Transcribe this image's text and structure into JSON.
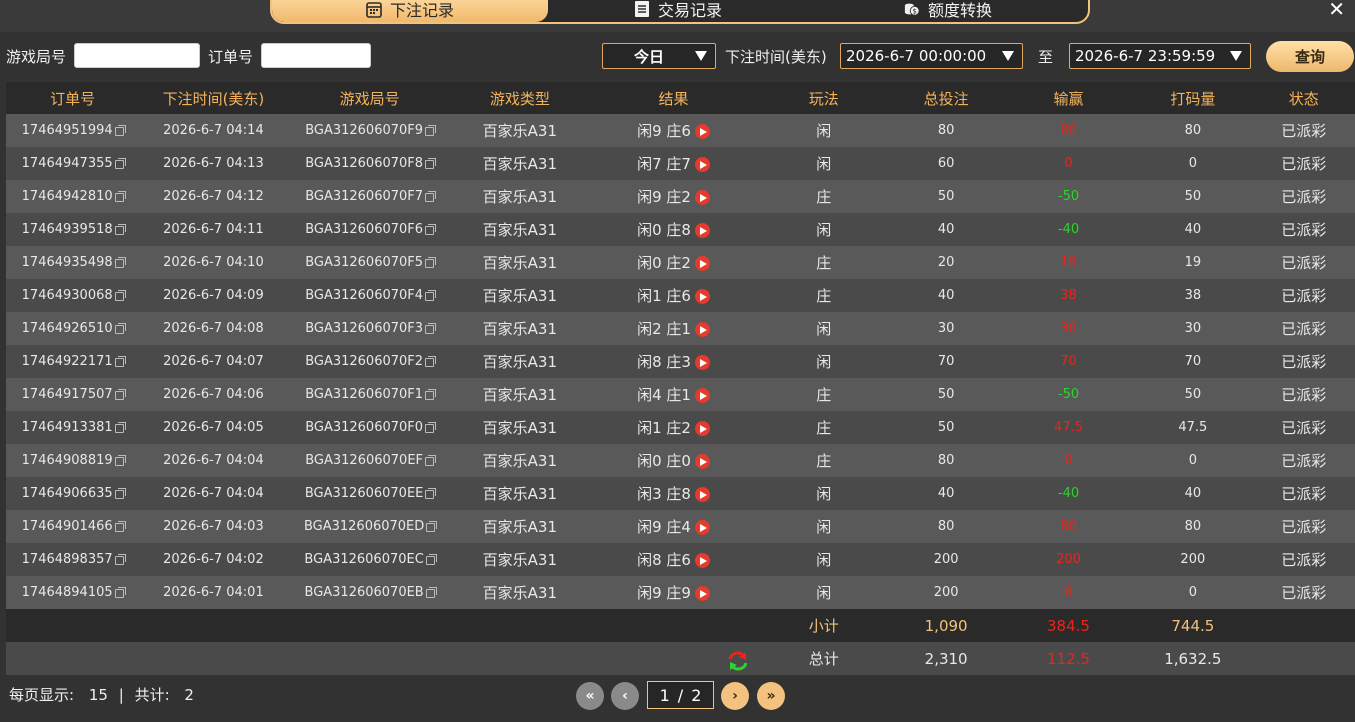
{
  "tabs": [
    {
      "label": "下注记录",
      "icon": "calendar-icon",
      "active": true
    },
    {
      "label": "交易记录",
      "icon": "document-icon",
      "active": false
    },
    {
      "label": "额度转换",
      "icon": "coins-icon",
      "active": false
    }
  ],
  "filter": {
    "round_label": "游戏局号",
    "round_value": "",
    "order_label": "订单号",
    "order_value": "",
    "period": "今日",
    "time_label": "下注时间(美东)",
    "start_time": "2026-6-7 00:00:00",
    "to_label": "至",
    "end_time": "2026-6-7 23:59:59",
    "query_label": "查询"
  },
  "columns": [
    "订单号",
    "下注时间(美东)",
    "游戏局号",
    "游戏类型",
    "结果",
    "玩法",
    "总投注",
    "输赢",
    "打码量",
    "状态"
  ],
  "rows": [
    {
      "order": "17464951994",
      "time": "2026-6-7 04:14",
      "round": "BGA312606070F9",
      "game": "百家乐A31",
      "result": "闲9 庄6",
      "play": "闲",
      "bet": "80",
      "winloss": "80",
      "wl_color": "red",
      "turnover": "80",
      "status": "已派彩"
    },
    {
      "order": "17464947355",
      "time": "2026-6-7 04:13",
      "round": "BGA312606070F8",
      "game": "百家乐A31",
      "result": "闲7 庄7",
      "play": "闲",
      "bet": "60",
      "winloss": "0",
      "wl_color": "red",
      "turnover": "0",
      "status": "已派彩"
    },
    {
      "order": "17464942810",
      "time": "2026-6-7 04:12",
      "round": "BGA312606070F7",
      "game": "百家乐A31",
      "result": "闲9 庄2",
      "play": "庄",
      "bet": "50",
      "winloss": "-50",
      "wl_color": "green",
      "turnover": "50",
      "status": "已派彩"
    },
    {
      "order": "17464939518",
      "time": "2026-6-7 04:11",
      "round": "BGA312606070F6",
      "game": "百家乐A31",
      "result": "闲0 庄8",
      "play": "闲",
      "bet": "40",
      "winloss": "-40",
      "wl_color": "green",
      "turnover": "40",
      "status": "已派彩"
    },
    {
      "order": "17464935498",
      "time": "2026-6-7 04:10",
      "round": "BGA312606070F5",
      "game": "百家乐A31",
      "result": "闲0 庄2",
      "play": "庄",
      "bet": "20",
      "winloss": "19",
      "wl_color": "red",
      "turnover": "19",
      "status": "已派彩"
    },
    {
      "order": "17464930068",
      "time": "2026-6-7 04:09",
      "round": "BGA312606070F4",
      "game": "百家乐A31",
      "result": "闲1 庄6",
      "play": "庄",
      "bet": "40",
      "winloss": "38",
      "wl_color": "red",
      "turnover": "38",
      "status": "已派彩"
    },
    {
      "order": "17464926510",
      "time": "2026-6-7 04:08",
      "round": "BGA312606070F3",
      "game": "百家乐A31",
      "result": "闲2 庄1",
      "play": "闲",
      "bet": "30",
      "winloss": "30",
      "wl_color": "red",
      "turnover": "30",
      "status": "已派彩"
    },
    {
      "order": "17464922171",
      "time": "2026-6-7 04:07",
      "round": "BGA312606070F2",
      "game": "百家乐A31",
      "result": "闲8 庄3",
      "play": "闲",
      "bet": "70",
      "winloss": "70",
      "wl_color": "red",
      "turnover": "70",
      "status": "已派彩"
    },
    {
      "order": "17464917507",
      "time": "2026-6-7 04:06",
      "round": "BGA312606070F1",
      "game": "百家乐A31",
      "result": "闲4 庄1",
      "play": "庄",
      "bet": "50",
      "winloss": "-50",
      "wl_color": "green",
      "turnover": "50",
      "status": "已派彩"
    },
    {
      "order": "17464913381",
      "time": "2026-6-7 04:05",
      "round": "BGA312606070F0",
      "game": "百家乐A31",
      "result": "闲1 庄2",
      "play": "庄",
      "bet": "50",
      "winloss": "47.5",
      "wl_color": "red",
      "turnover": "47.5",
      "status": "已派彩"
    },
    {
      "order": "17464908819",
      "time": "2026-6-7 04:04",
      "round": "BGA312606070EF",
      "game": "百家乐A31",
      "result": "闲0 庄0",
      "play": "庄",
      "bet": "80",
      "winloss": "0",
      "wl_color": "red",
      "turnover": "0",
      "status": "已派彩"
    },
    {
      "order": "17464906635",
      "time": "2026-6-7 04:04",
      "round": "BGA312606070EE",
      "game": "百家乐A31",
      "result": "闲3 庄8",
      "play": "闲",
      "bet": "40",
      "winloss": "-40",
      "wl_color": "green",
      "turnover": "40",
      "status": "已派彩"
    },
    {
      "order": "17464901466",
      "time": "2026-6-7 04:03",
      "round": "BGA312606070ED",
      "game": "百家乐A31",
      "result": "闲9 庄4",
      "play": "闲",
      "bet": "80",
      "winloss": "80",
      "wl_color": "red",
      "turnover": "80",
      "status": "已派彩"
    },
    {
      "order": "17464898357",
      "time": "2026-6-7 04:02",
      "round": "BGA312606070EC",
      "game": "百家乐A31",
      "result": "闲8 庄6",
      "play": "闲",
      "bet": "200",
      "winloss": "200",
      "wl_color": "red",
      "turnover": "200",
      "status": "已派彩"
    },
    {
      "order": "17464894105",
      "time": "2026-6-7 04:01",
      "round": "BGA312606070EB",
      "game": "百家乐A31",
      "result": "闲9 庄9",
      "play": "闲",
      "bet": "200",
      "winloss": "0",
      "wl_color": "red",
      "turnover": "0",
      "status": "已派彩"
    }
  ],
  "subtotal": {
    "label": "小计",
    "bet": "1,090",
    "winloss": "384.5",
    "turnover": "744.5"
  },
  "total": {
    "label": "总计",
    "bet": "2,310",
    "winloss": "112.5",
    "turnover": "1,632.5"
  },
  "footer": {
    "per_page_label": "每页显示:",
    "per_page": "15",
    "separator": "|",
    "total_label": "共计:",
    "total_pages": "2",
    "current_page": "1",
    "page_sep": "/",
    "page_count": "2"
  },
  "colors": {
    "accent": "#f2c27e",
    "win": "#e8251b",
    "loss": "#29d629",
    "header_text": "#f4b35a"
  }
}
